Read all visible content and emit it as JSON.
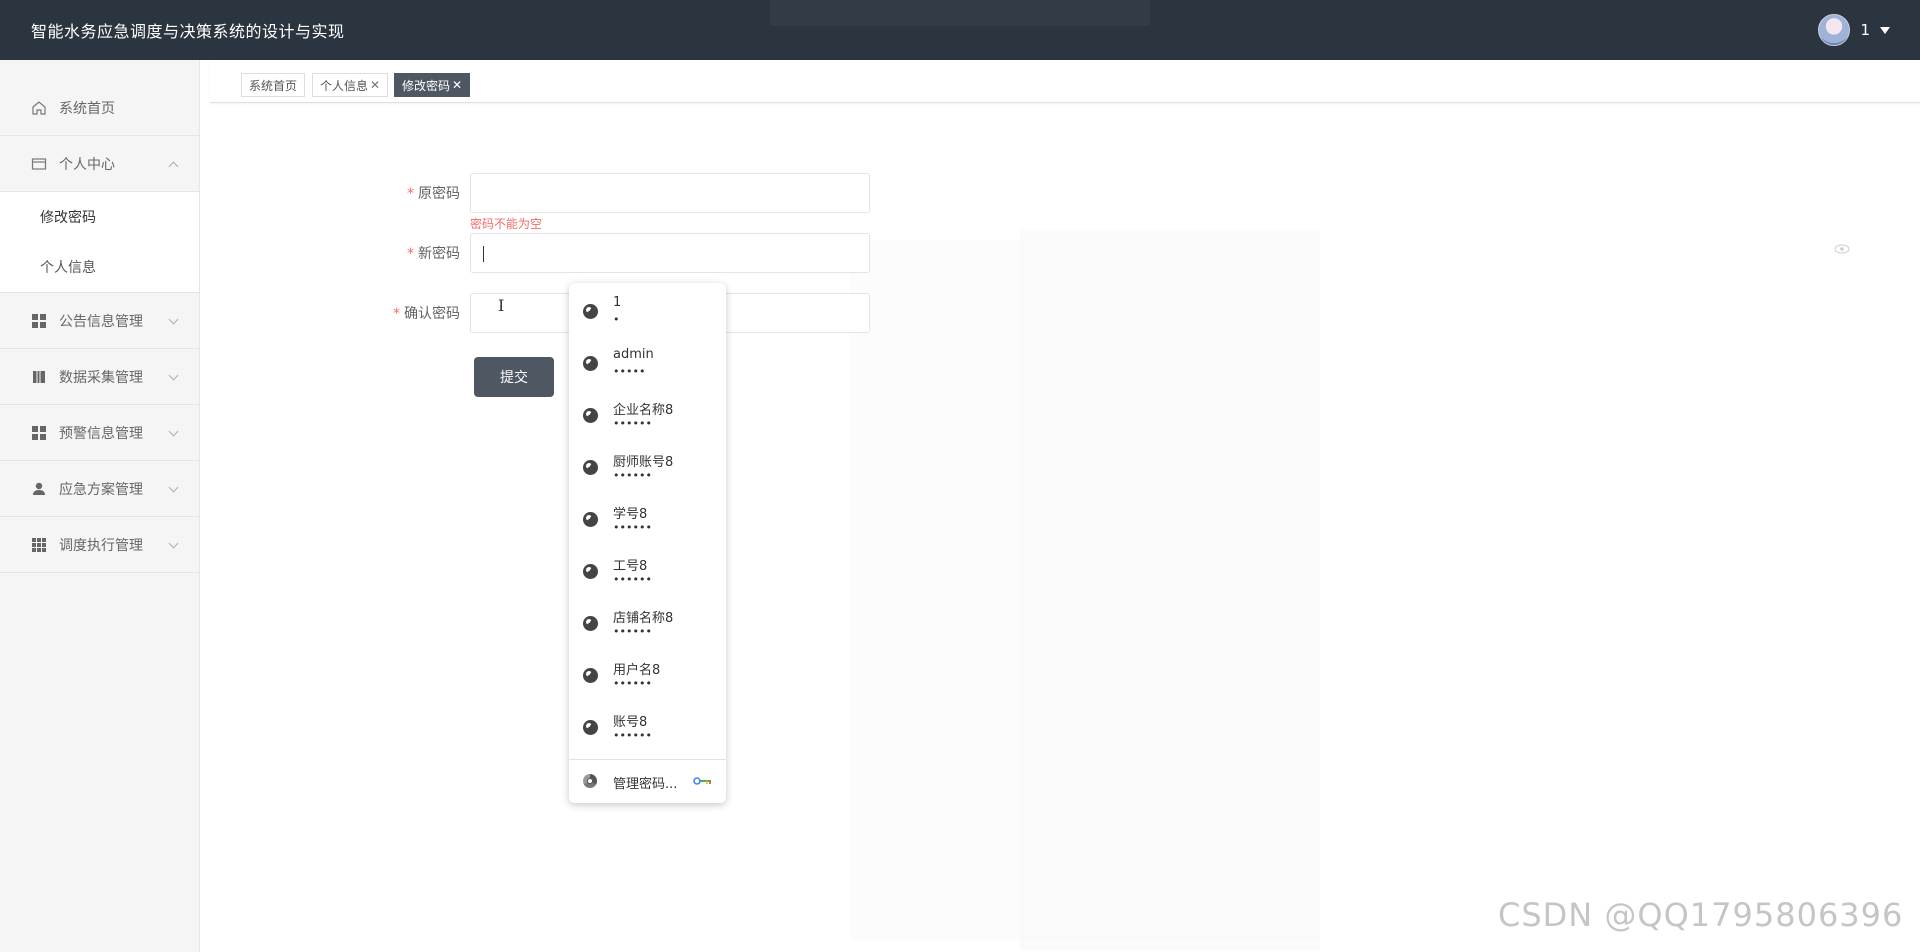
{
  "app": {
    "title": "智能水务应急调度与决策系统的设计与实现"
  },
  "user": {
    "name": "1"
  },
  "sidebar": {
    "items": [
      {
        "label": "系统首页",
        "icon": "home-icon"
      },
      {
        "label": "个人中心",
        "icon": "card-icon",
        "expanded": true,
        "children": [
          {
            "label": "修改密码",
            "active": true
          },
          {
            "label": "个人信息"
          }
        ]
      },
      {
        "label": "公告信息管理",
        "icon": "grid-icon"
      },
      {
        "label": "数据采集管理",
        "icon": "book-icon"
      },
      {
        "label": "预警信息管理",
        "icon": "grid-icon"
      },
      {
        "label": "应急方案管理",
        "icon": "person-icon"
      },
      {
        "label": "调度执行管理",
        "icon": "grid9-icon"
      }
    ]
  },
  "tabs": [
    {
      "label": "系统首页",
      "closable": false
    },
    {
      "label": "个人信息",
      "closable": true
    },
    {
      "label": "修改密码",
      "closable": true,
      "active": true
    }
  ],
  "close_glyph": "✕",
  "form": {
    "old_password": {
      "label": "原密码",
      "value": "",
      "error": "密码不能为空"
    },
    "new_password": {
      "label": "新密码",
      "value": ""
    },
    "confirm_password": {
      "label": "确认密码",
      "value": ""
    },
    "required_mark": "*",
    "submit_label": "提交"
  },
  "password_suggestions": {
    "items": [
      {
        "username": "1",
        "masked": "•"
      },
      {
        "username": "admin",
        "masked": "•••••"
      },
      {
        "username": "企业名称8",
        "masked": "••••••"
      },
      {
        "username": "厨师账号8",
        "masked": "••••••"
      },
      {
        "username": "学号8",
        "masked": "••••••"
      },
      {
        "username": "工号8",
        "masked": "••••••"
      },
      {
        "username": "店铺名称8",
        "masked": "••••••"
      },
      {
        "username": "用户名8",
        "masked": "••••••"
      },
      {
        "username": "账号8",
        "masked": "••••••"
      }
    ],
    "manage_label": "管理密码..."
  },
  "watermark": "CSDN @QQ1795806396",
  "colors": {
    "topbar": "#2b3540",
    "active_tab": "#4f5862",
    "error": "#f56c6c"
  }
}
